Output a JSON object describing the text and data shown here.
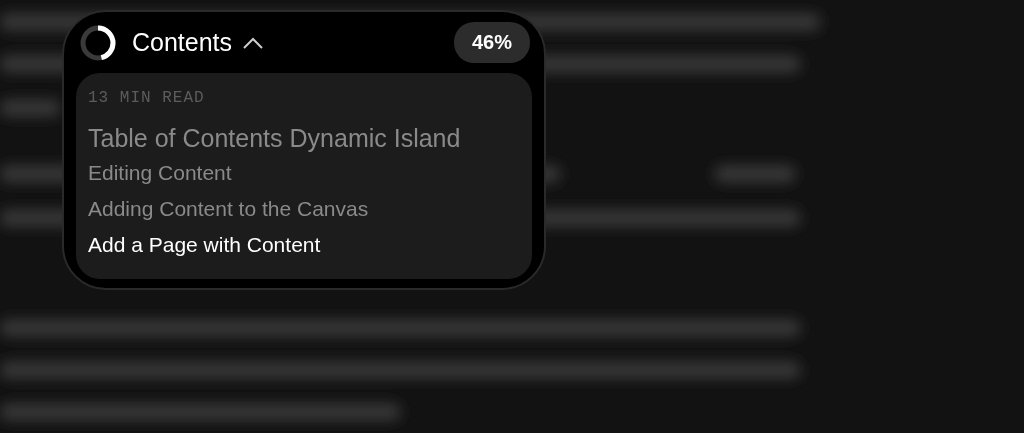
{
  "island": {
    "title": "Contents",
    "expanded": true,
    "progress": {
      "reading": "46%"
    },
    "read_time": "13 MIN READ",
    "items": [
      {
        "label": "Table of Contents Dynamic Island",
        "kind": "heading",
        "selected": false
      },
      {
        "label": "Editing Content",
        "kind": "section",
        "selected": false
      },
      {
        "label": "Adding Content to the Canvas",
        "kind": "section",
        "selected": false
      },
      {
        "label": "Add a Page with Content",
        "kind": "section",
        "selected": true
      }
    ]
  }
}
